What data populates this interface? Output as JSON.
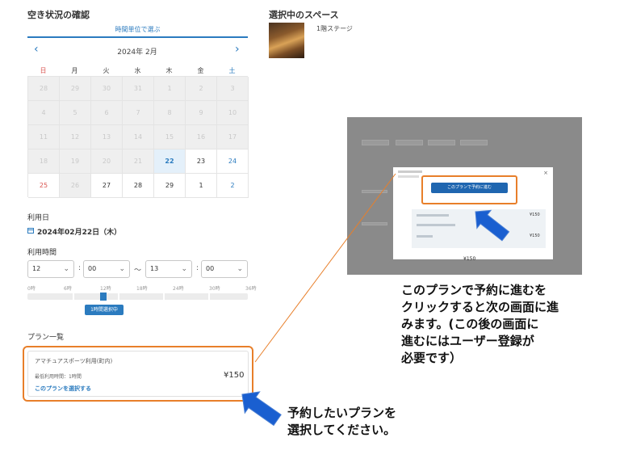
{
  "availability": {
    "title": "空き状況の確認",
    "tab_label": "時間単位で選ぶ",
    "month_label": "2024年 2月",
    "prev_arrow": "‹",
    "next_arrow": "›",
    "weekdays": [
      "日",
      "月",
      "火",
      "水",
      "木",
      "金",
      "土"
    ],
    "weeks": [
      [
        "28",
        "29",
        "30",
        "31",
        "1",
        "2",
        "3"
      ],
      [
        "4",
        "5",
        "6",
        "7",
        "8",
        "9",
        "10"
      ],
      [
        "11",
        "12",
        "13",
        "14",
        "15",
        "16",
        "17"
      ],
      [
        "18",
        "19",
        "20",
        "21",
        "22",
        "23",
        "24"
      ],
      [
        "25",
        "26",
        "27",
        "28",
        "29",
        "1",
        "2"
      ]
    ],
    "selected_day": "22"
  },
  "usage_date": {
    "label": "利用日",
    "value": "2024年02月22日（木）"
  },
  "usage_time": {
    "label": "利用時間",
    "start_hour": "12",
    "start_min": "00",
    "end_hour": "13",
    "end_min": "00",
    "separator": "〜",
    "colon": ":",
    "ticks": [
      "0時",
      "6時",
      "12時",
      "18時",
      "24時",
      "30時",
      "36時"
    ],
    "slider_tooltip": "1時間選択中"
  },
  "plans": {
    "title": "プラン一覧",
    "items": [
      {
        "name": "アマチュアスポーツ利用(町内)",
        "duration": "最低利用時間：1時間",
        "price": "¥150",
        "select_link": "このプランを選択する"
      }
    ]
  },
  "selected_space": {
    "title": "選択中のスペース",
    "name": "1階ステージ"
  },
  "inset_modal": {
    "button_label": "このプランで予約に進む",
    "price_1": "¥150",
    "price_2": "¥150",
    "bottom_price": "¥150"
  },
  "annotations": {
    "callout_right": [
      "このプランで予約に進むを",
      "クリックすると次の画面に進",
      "みます。(この後の画面に",
      "進むにはユーザー登録が",
      "必要です）"
    ],
    "callout_bottom": [
      "予約したいプランを",
      "選択してください。"
    ]
  },
  "colors": {
    "accent_blue": "#2b7bbf",
    "highlight_orange": "#e87f2a",
    "arrow_blue": "#1a5fd0"
  }
}
